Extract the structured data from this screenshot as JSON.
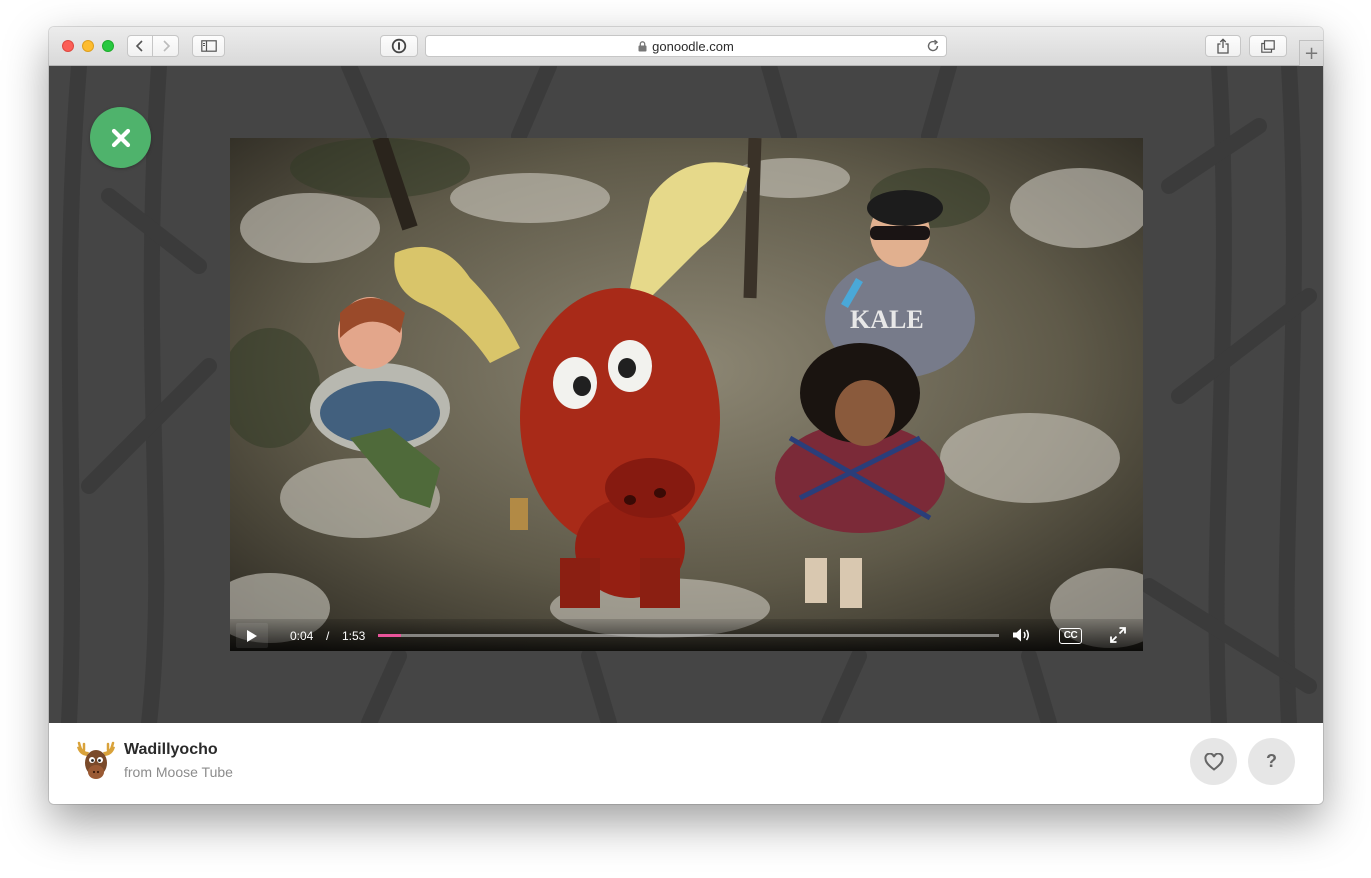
{
  "browser": {
    "url": "gonoodle.com",
    "new_tab_label": "+"
  },
  "video": {
    "current_time": "0:04",
    "separator": "/",
    "duration": "1:53",
    "progress_fraction": 0.037,
    "cc_label": "CC",
    "shirt_text": "KALE"
  },
  "footer": {
    "title": "Wadillyocho",
    "source": "from Moose Tube",
    "help_label": "?"
  },
  "colors": {
    "close_button": "#4fb36c",
    "progress_fill": "#e9549a",
    "stage_background": "#454545"
  }
}
